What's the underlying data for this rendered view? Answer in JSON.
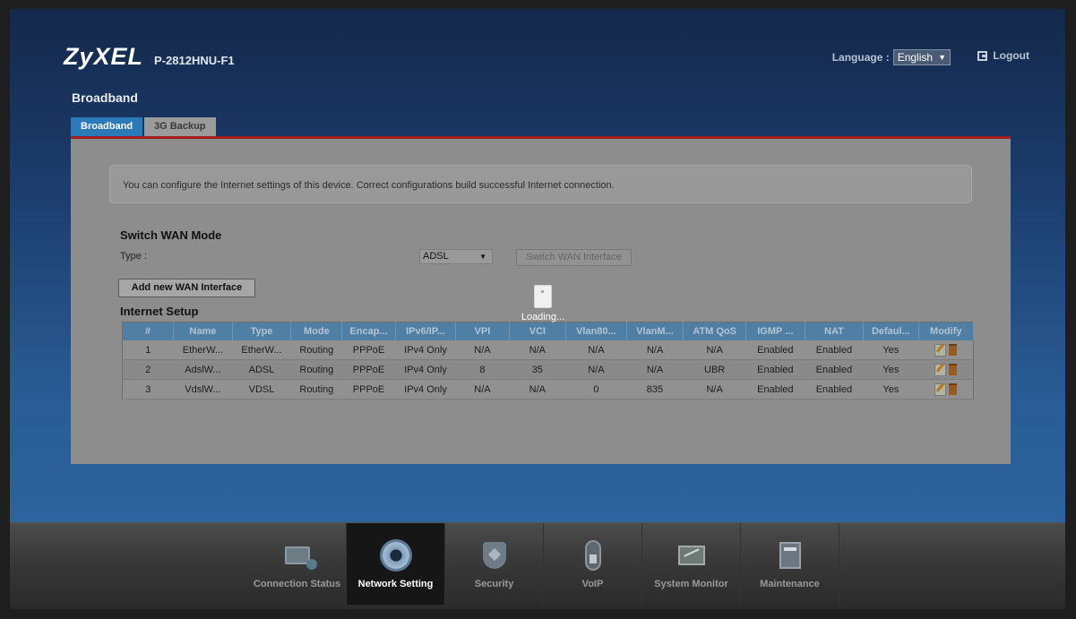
{
  "header": {
    "brand": "ZyXEL",
    "model": "P-2812HNU-F1",
    "language_label": "Language :",
    "language_value": "English",
    "logout_label": "Logout"
  },
  "page": {
    "title": "Broadband",
    "tabs": [
      {
        "label": "Broadband",
        "active": true
      },
      {
        "label": "3G Backup",
        "active": false
      }
    ],
    "info_text": "You can configure the Internet settings of this device. Correct configurations build successful Internet connection."
  },
  "switch_wan": {
    "title": "Switch WAN Mode",
    "type_label": "Type :",
    "type_value": "ADSL",
    "switch_button": "Switch WAN Interface"
  },
  "internet_setup": {
    "add_button": "Add new WAN Interface",
    "title": "Internet Setup",
    "columns": [
      "#",
      "Name",
      "Type",
      "Mode",
      "Encap...",
      "IPv6/IP...",
      "VPI",
      "VCI",
      "Vlan80...",
      "VlanM...",
      "ATM QoS",
      "IGMP ...",
      "NAT",
      "Defaul...",
      "Modify"
    ],
    "rows": [
      [
        "1",
        "EtherW...",
        "EtherW...",
        "Routing",
        "PPPoE",
        "IPv4 Only",
        "N/A",
        "N/A",
        "N/A",
        "N/A",
        "N/A",
        "Enabled",
        "Enabled",
        "Yes"
      ],
      [
        "2",
        "AdslW...",
        "ADSL",
        "Routing",
        "PPPoE",
        "IPv4 Only",
        "8",
        "35",
        "N/A",
        "N/A",
        "UBR",
        "Enabled",
        "Enabled",
        "Yes"
      ],
      [
        "3",
        "VdslW...",
        "VDSL",
        "Routing",
        "PPPoE",
        "IPv4 Only",
        "N/A",
        "N/A",
        "0",
        "835",
        "N/A",
        "Enabled",
        "Enabled",
        "Yes"
      ]
    ]
  },
  "loading_text": "Loading...",
  "bottom_nav": [
    {
      "label": "Connection Status",
      "icon": "connection-status-icon",
      "active": false
    },
    {
      "label": "Network Setting",
      "icon": "gear-icon",
      "active": true
    },
    {
      "label": "Security",
      "icon": "shield-icon",
      "active": false
    },
    {
      "label": "VoIP",
      "icon": "phone-icon",
      "active": false
    },
    {
      "label": "System Monitor",
      "icon": "monitor-chart-icon",
      "active": false
    },
    {
      "label": "Maintenance",
      "icon": "tools-icon",
      "active": false
    }
  ]
}
